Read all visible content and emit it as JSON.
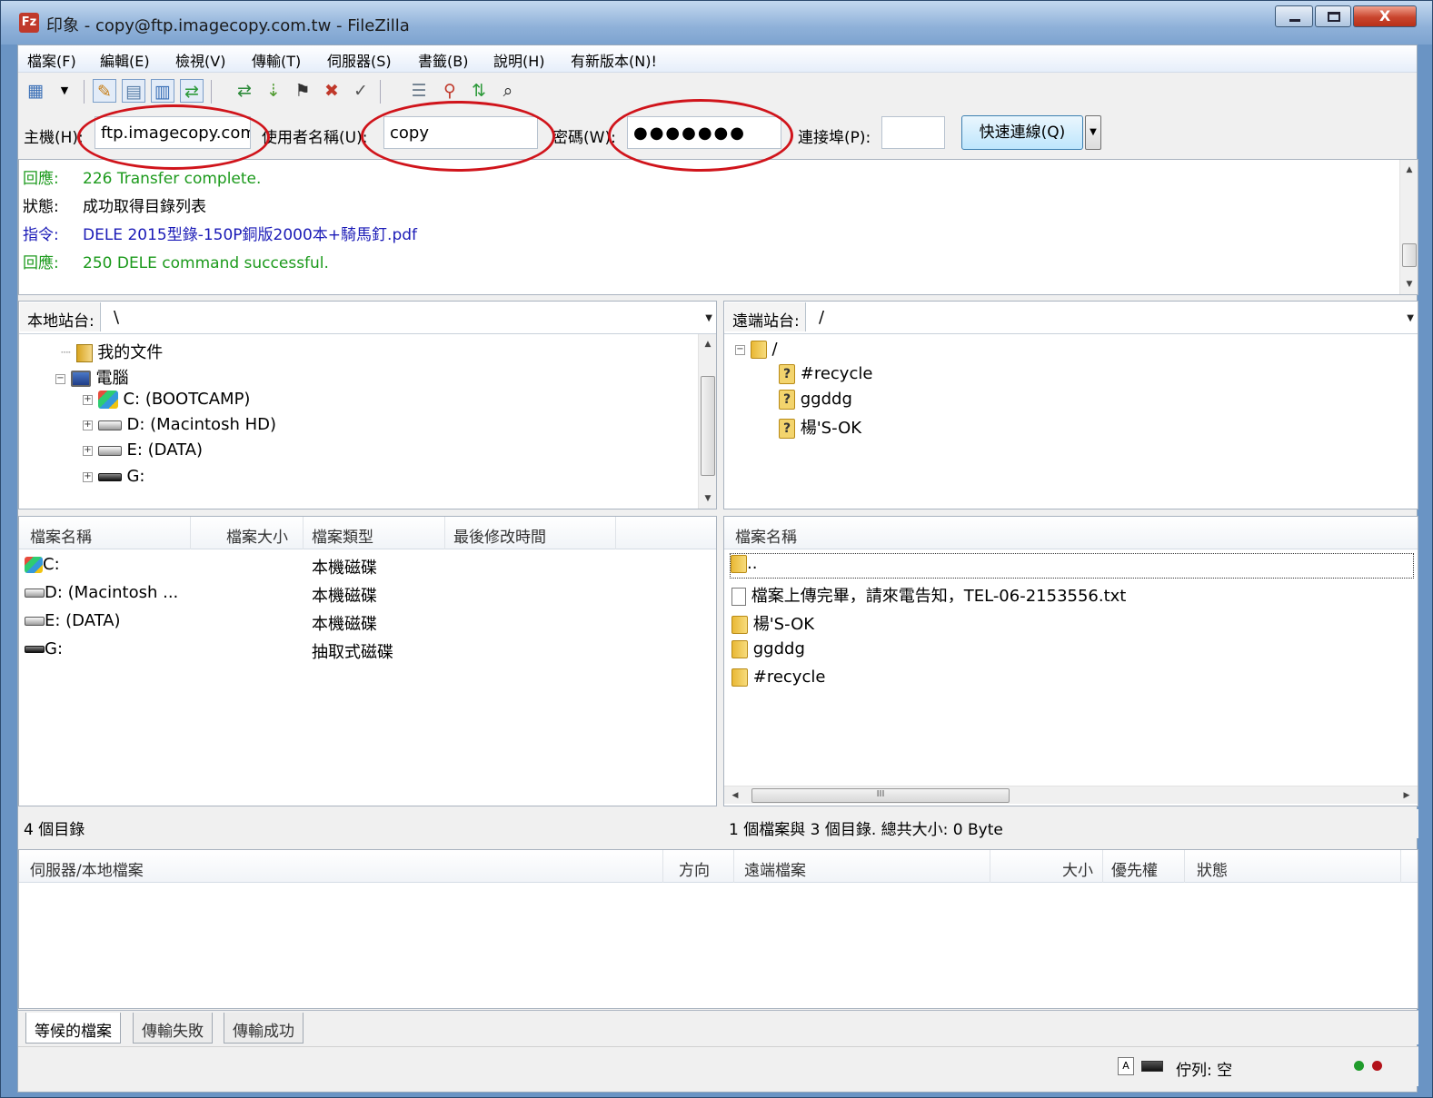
{
  "window": {
    "title": "印象 - copy@ftp.imagecopy.com.tw - FileZilla",
    "app_icon": "Fz",
    "close_symbol": "X"
  },
  "menu": {
    "items": [
      "檔案(F)",
      "編輯(E)",
      "檢視(V)",
      "傳輸(T)",
      "伺服器(S)",
      "書籤(B)",
      "說明(H)",
      "有新版本(N)!"
    ]
  },
  "toolbar": {
    "icons": [
      "site-manager-icon",
      "dropdown-icon",
      "toggle-log-icon",
      "toggle-local-tree-icon",
      "toggle-remote-tree-icon",
      "toggle-queue-icon",
      "refresh-icon",
      "process-queue-icon",
      "cancel-icon",
      "disconnect-icon",
      "reconnect-icon",
      "directory-listing-filter-icon",
      "sync-browsing-icon",
      "compare-dirs-icon",
      "search-icon"
    ]
  },
  "quickconnect": {
    "host_label": "主機(H):",
    "host_value": "ftp.imagecopy.com.tw",
    "user_label": "使用者名稱(U):",
    "user_value": "copy",
    "pass_label": "密碼(W):",
    "pass_value": "●●●●●●●",
    "port_label": "連接埠(P):",
    "port_value": "",
    "button_label": "快速連線(Q)",
    "dropdown_symbol": "▼"
  },
  "log": [
    {
      "tag": "回應:",
      "text": "226 Transfer complete.",
      "color": "#1c9a1c"
    },
    {
      "tag": "狀態:",
      "text": "成功取得目錄列表",
      "color": "#000000"
    },
    {
      "tag": "指令:",
      "text": "DELE 2015型錄-150P銅版2000本+騎馬釘.pdf",
      "color": "#1b1bb7"
    },
    {
      "tag": "回應:",
      "text": "250 DELE command successful.",
      "color": "#1c9a1c"
    }
  ],
  "local": {
    "site_label": "本地站台:",
    "site_path": "\\",
    "tree": [
      {
        "label": "我的文件",
        "icon": "documents-folder-icon"
      },
      {
        "label": "電腦",
        "icon": "computer-icon"
      },
      {
        "label": "C: (BOOTCAMP)",
        "icon": "windows-drive-icon"
      },
      {
        "label": "D: (Macintosh HD)",
        "icon": "hard-drive-icon"
      },
      {
        "label": "E: (DATA)",
        "icon": "hard-drive-icon"
      },
      {
        "label": "G:",
        "icon": "removable-drive-icon"
      }
    ],
    "columns": [
      "檔案名稱",
      "檔案大小",
      "檔案類型",
      "最後修改時間"
    ],
    "files": [
      {
        "name": "C:",
        "size": "",
        "type": "本機磁碟",
        "modified": "",
        "icon": "windows-drive-icon"
      },
      {
        "name": "D: (Macintosh ...",
        "size": "",
        "type": "本機磁碟",
        "modified": "",
        "icon": "hard-drive-icon"
      },
      {
        "name": "E: (DATA)",
        "size": "",
        "type": "本機磁碟",
        "modified": "",
        "icon": "hard-drive-icon"
      },
      {
        "name": "G:",
        "size": "",
        "type": "抽取式磁碟",
        "modified": "",
        "icon": "removable-drive-icon"
      }
    ],
    "status": "4 個目錄"
  },
  "remote": {
    "site_label": "遠端站台:",
    "site_path": "/",
    "tree": [
      {
        "label": "/",
        "icon": "folder-icon"
      },
      {
        "label": "#recycle",
        "icon": "unknown-folder-icon"
      },
      {
        "label": "ggddg",
        "icon": "unknown-folder-icon"
      },
      {
        "label": "楊'S-OK",
        "icon": "unknown-folder-icon"
      }
    ],
    "columns": [
      "檔案名稱"
    ],
    "files": [
      {
        "name": "..",
        "icon": "folder-icon"
      },
      {
        "name": "檔案上傳完畢，請來電告知，TEL-06-2153556.txt",
        "icon": "file-icon"
      },
      {
        "name": "楊'S-OK",
        "icon": "folder-icon"
      },
      {
        "name": "ggddg",
        "icon": "folder-icon"
      },
      {
        "name": "#recycle",
        "icon": "folder-icon"
      }
    ],
    "scroll_thumb_mark": "III",
    "status": "1 個檔案與 3 個目錄. 總共大小: 0 Byte"
  },
  "queue": {
    "columns": [
      "伺服器/本地檔案",
      "方向",
      "遠端檔案",
      "大小",
      "優先權",
      "狀態"
    ]
  },
  "tabs": [
    "等候的檔案",
    "傳輸失敗",
    "傳輸成功"
  ],
  "statusbar": {
    "queue_text": "佇列: 空",
    "led_colors": [
      "#1f9b2b",
      "#b3121a"
    ]
  },
  "annotation_color": "#d0141b"
}
